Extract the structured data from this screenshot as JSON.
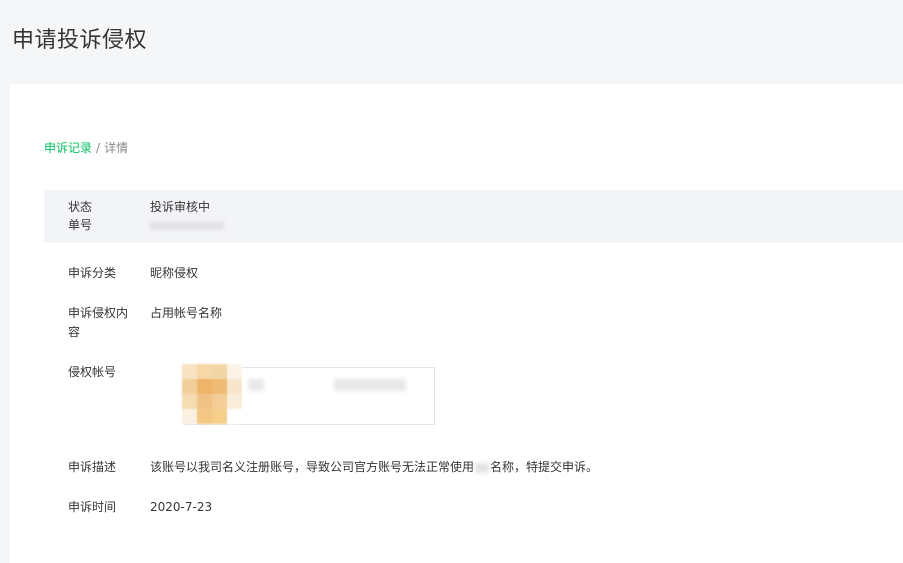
{
  "header": {
    "title": "申请投诉侵权"
  },
  "breadcrumb": {
    "link_label": "申诉记录",
    "separator": "/",
    "current_label": "详情"
  },
  "status": {
    "label": "状态",
    "value": "投诉审核中",
    "number_label": "单号"
  },
  "details": {
    "category_label": "申诉分类",
    "category_value": "昵称侵权",
    "content_label": "申诉侵权内容",
    "content_value": "占用帐号名称",
    "account_label": "侵权帐号",
    "description_label": "申诉描述",
    "description_before": "该账号以我司名义注册账号，导致公司官方账号无法正常使用",
    "description_after": "名称，特提交申诉。",
    "time_label": "申诉时间",
    "time_value": "2020-7-23"
  },
  "colors": {
    "accent": "#07c160",
    "band": "#f3f4f7",
    "page_bg": "#f5f6f7"
  }
}
